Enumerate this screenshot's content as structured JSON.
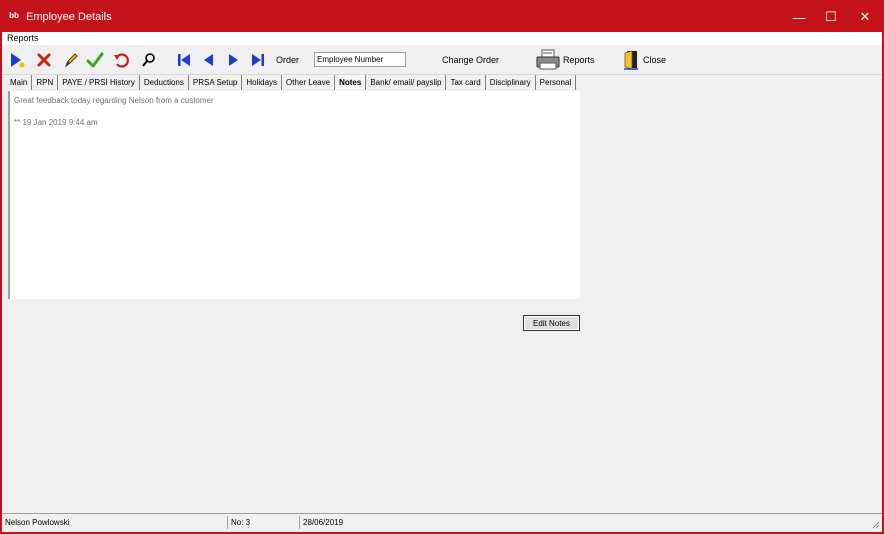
{
  "window": {
    "title": "Employee Details",
    "app_icon_text": "bb",
    "controls": {
      "minimize": "—",
      "maximize": "☐",
      "close": "✕"
    }
  },
  "menu": {
    "items": [
      "Reports"
    ]
  },
  "toolbar": {
    "order_label": "Order",
    "order_value": "Employee Number",
    "change_order_label": "Change Order",
    "reports_label": "Reports",
    "close_label": "Close",
    "icons": [
      "add-icon",
      "delete-icon",
      "edit-icon",
      "save-icon",
      "undo-icon",
      "search-icon",
      "first-record-icon",
      "previous-record-icon",
      "next-record-icon",
      "last-record-icon",
      "printer-icon",
      "door-exit-icon"
    ],
    "colors": {
      "nav_blue": "#1f3cd0",
      "delete_red": "#d0201a",
      "save_green": "#3aa320"
    }
  },
  "tabs": [
    "Main",
    "RPN",
    "PAYE / PRSI History",
    "Deductions",
    "PRSA Setup",
    "Holidays",
    "Other Leave",
    "Notes",
    "Bank/ email/ payslip",
    "Tax card",
    "Disciplinary",
    "Personal"
  ],
  "active_tab": "Notes",
  "notes": {
    "lines": [
      "Great feedback today regarding Nelson from a customer",
      "** 19 Jan 2019  9:44 am"
    ]
  },
  "edit_notes_label": "Edit Notes",
  "status": {
    "employee_name": "Nelson Powlowski",
    "number": "No: 3",
    "date": "28/06/2019"
  },
  "accent_color": "#c4121a"
}
